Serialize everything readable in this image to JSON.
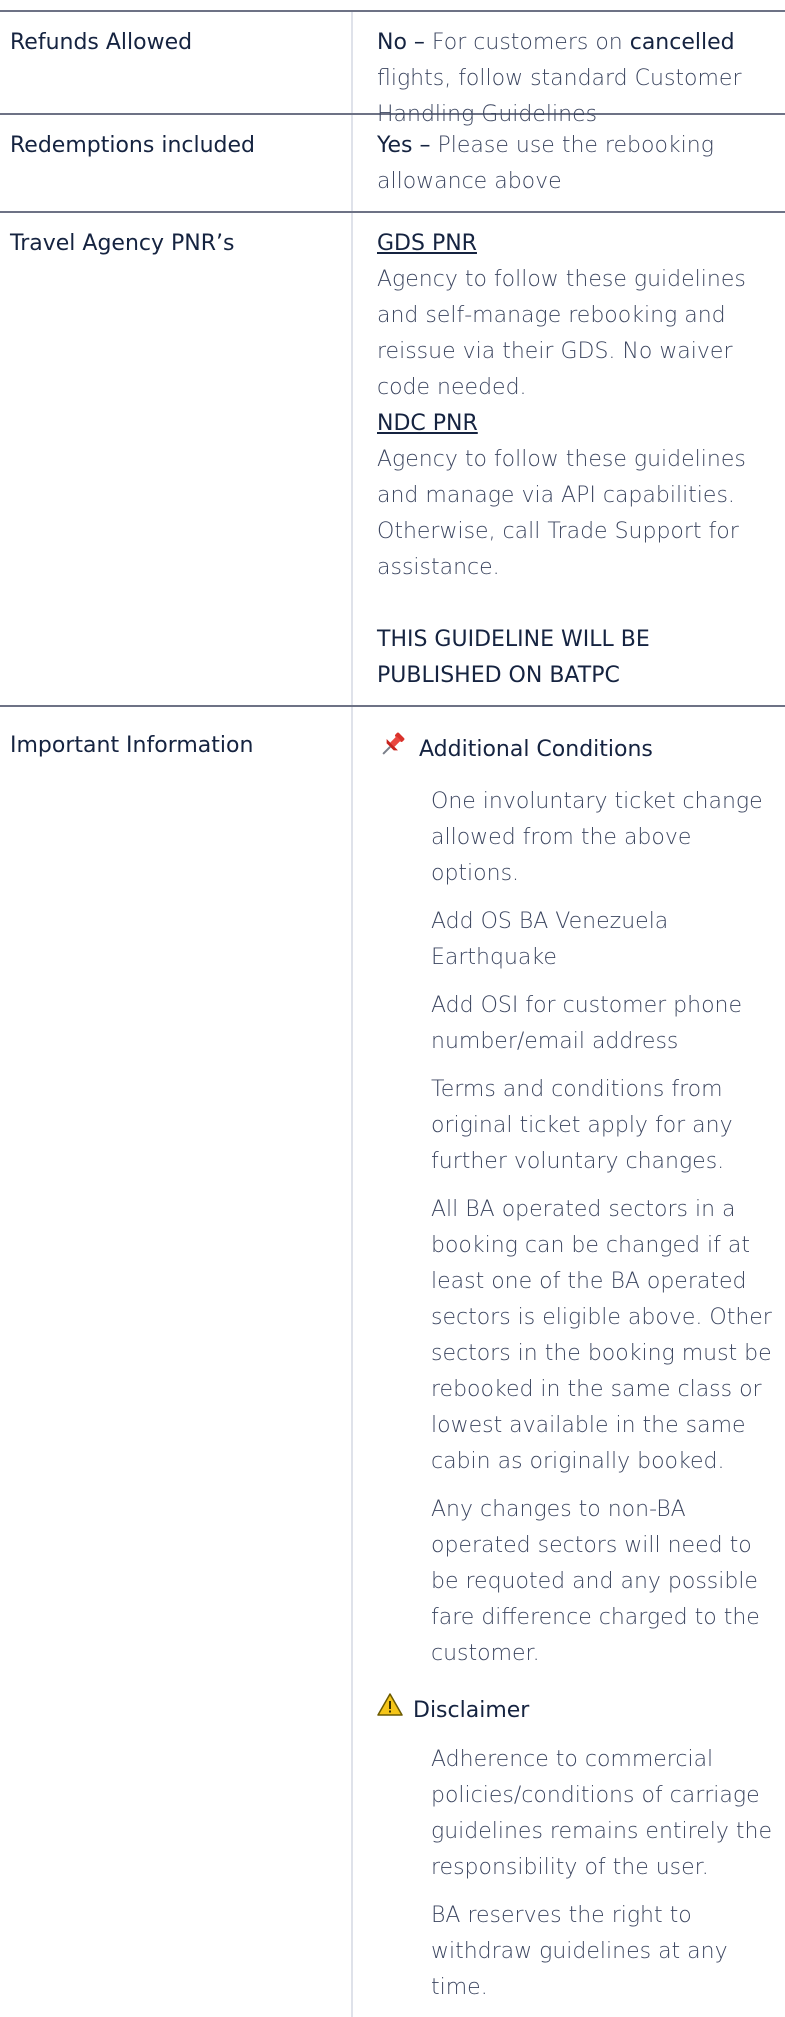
{
  "rows": {
    "refunds": {
      "label": "Refunds Allowed",
      "value_strong": "No –",
      "value_part1": " For customers on ",
      "value_strong2": "cancelled",
      "value_part2": " flights, follow standard Customer Handling Guidelines"
    },
    "redemptions": {
      "label": "Redemptions included",
      "value_strong": "Yes –",
      "value_rest": " Please use the rebooking allowance above"
    },
    "agency": {
      "label": "Travel Agency PNR’s",
      "gds_heading": "GDS PNR",
      "gds_text": "Agency to follow these guidelines and self-manage rebooking and reissue via their GDS. No waiver code needed.",
      "ndc_heading": "NDC PNR",
      "ndc_text": "Agency to follow these guidelines and manage via API capabilities. Otherwise, call Trade Support for assistance.",
      "published_note": "THIS GUIDELINE WILL BE PUBLISHED ON BATPC"
    },
    "important": {
      "label": "Important Information",
      "additional": {
        "icon": "pushpin-icon",
        "heading": "Additional Conditions",
        "items": [
          "One involuntary ticket change allowed from the above options.",
          "Add OS BA Venezuela Earthquake",
          "Add OSI for customer phone number/email address",
          "Terms and conditions from original ticket apply for any further voluntary changes.",
          "All BA operated sectors in a booking can be changed if at least one of the BA operated sectors is eligible above. Other sectors in the booking must be rebooked in the same class or lowest available in the same cabin as originally booked.",
          "Any changes to non-BA operated sectors will need to be requoted and any possible fare difference charged to the customer."
        ]
      },
      "disclaimer": {
        "icon": "warning-icon",
        "heading": "Disclaimer",
        "items": [
          "Adherence to commercial policies/conditions of carriage guidelines remains entirely the responsibility of the user.",
          "BA reserves the right to withdraw guidelines at any time."
        ]
      }
    }
  },
  "colors": {
    "rule": "#6d7285",
    "divider": "#dfe2ea",
    "text_dark": "#152340",
    "text_body": "#3c4660",
    "pin_red": "#d9322b",
    "warning_yellow": "#f5c518"
  }
}
